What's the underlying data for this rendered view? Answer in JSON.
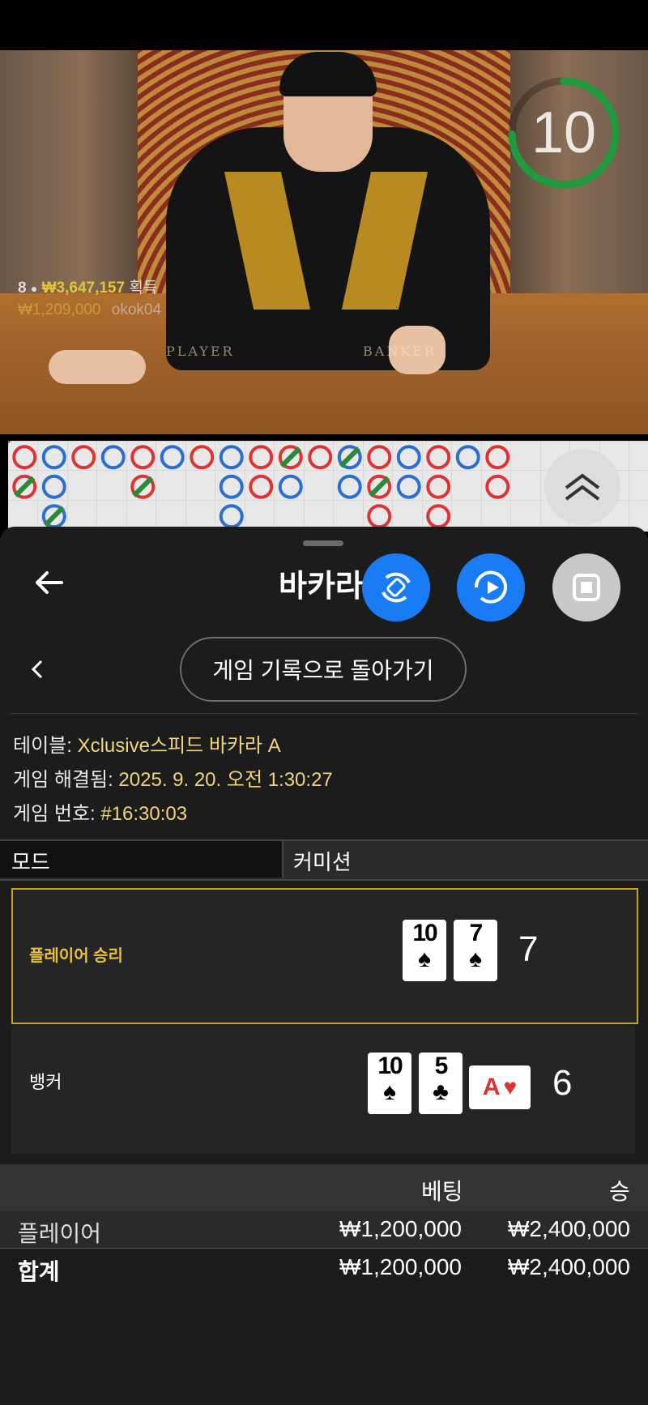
{
  "video": {
    "timer": "10",
    "felt_left": "PLAYER",
    "felt_right": "BANKER",
    "winners_count": "8",
    "winners_amount": "₩3,647,157",
    "winners_suffix": "획득",
    "bet_amount": "₩1,209,000",
    "bet_user": "okok04"
  },
  "header": {
    "title": "바카라"
  },
  "nav": {
    "back_to_history": "게임 기록으로 돌아가기"
  },
  "details": {
    "table_label": "테이블:",
    "table_value": "Xclusive스피드 바카라 A",
    "resolved_label": "게임 해결됨:",
    "resolved_value": "2025. 9. 20. 오전 1:30:27",
    "number_label": "게임 번호:",
    "number_value": "#16:30:03"
  },
  "mode": {
    "label": "모드",
    "value": "커미션"
  },
  "results": {
    "player": {
      "label": "플레이어 승리",
      "cards": [
        {
          "rank": "10",
          "suit": "♠"
        },
        {
          "rank": "7",
          "suit": "♠"
        }
      ],
      "score": "7"
    },
    "banker": {
      "label": "뱅커",
      "cards": [
        {
          "rank": "10",
          "suit": "♠"
        },
        {
          "rank": "5",
          "suit": "♣"
        }
      ],
      "third_card": {
        "rank": "A",
        "suit": "♥"
      },
      "score": "6"
    }
  },
  "bets": {
    "col_bet": "베팅",
    "col_win": "승",
    "rows": [
      {
        "name": "플레이어",
        "bet": "₩1,200,000",
        "win": "₩2,400,000"
      }
    ],
    "total": {
      "name": "합계",
      "bet": "₩1,200,000",
      "win": "₩2,400,000"
    }
  },
  "colors": {
    "accent_blue": "#1a7cf5",
    "gold": "#e8c23a",
    "banker_red": "#d33",
    "player_blue": "#2a6fd0",
    "tie_green": "#2a8a3a"
  }
}
